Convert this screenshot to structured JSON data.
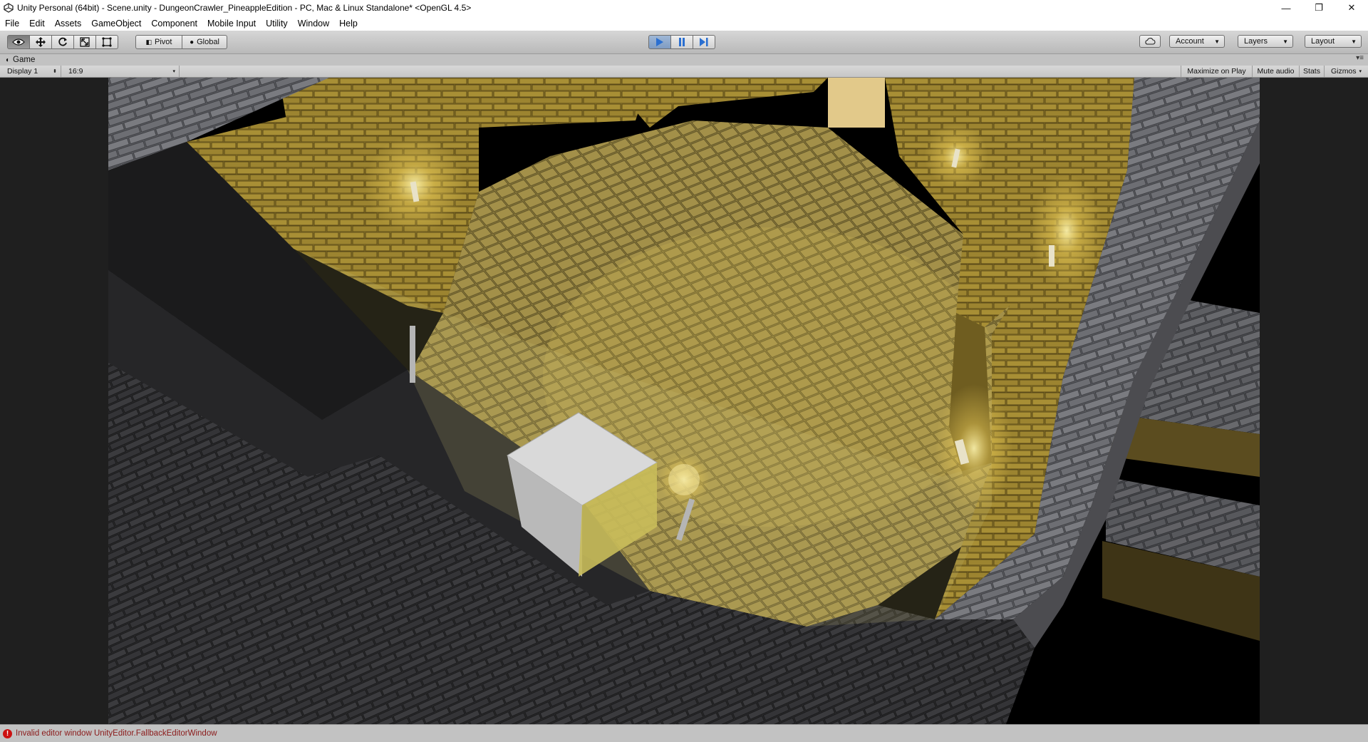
{
  "window": {
    "title": "Unity Personal (64bit) - Scene.unity - DungeonCrawler_PineappleEdition - PC, Mac & Linux Standalone* <OpenGL 4.5>",
    "minimize_glyph": "—",
    "maximize_glyph": "❐",
    "close_glyph": "✕"
  },
  "menu": [
    "File",
    "Edit",
    "Assets",
    "GameObject",
    "Component",
    "Mobile Input",
    "Utility",
    "Window",
    "Help"
  ],
  "toolbar": {
    "transform_tools": [
      "hand-tool",
      "move-tool",
      "rotate-tool",
      "scale-tool",
      "rect-tool"
    ],
    "pivot_label": "Pivot",
    "global_label": "Global",
    "play_controls": [
      "play",
      "pause",
      "step"
    ],
    "account_label": "Account",
    "layers_label": "Layers",
    "layout_label": "Layout"
  },
  "game_tab": {
    "label": "Game",
    "display_label": "Display 1",
    "aspect_label": "16:9",
    "maximize_on_play": "Maximize on Play",
    "mute_audio": "Mute audio",
    "stats": "Stats",
    "gizmos": "Gizmos"
  },
  "status": {
    "message": "Invalid editor window UnityEditor.FallbackEditorWindow"
  },
  "colors": {
    "accent_play": "#3b78c8",
    "error": "#c11111",
    "floor_lit": "#b8a04a",
    "wall_stone": "#6b6b70"
  }
}
